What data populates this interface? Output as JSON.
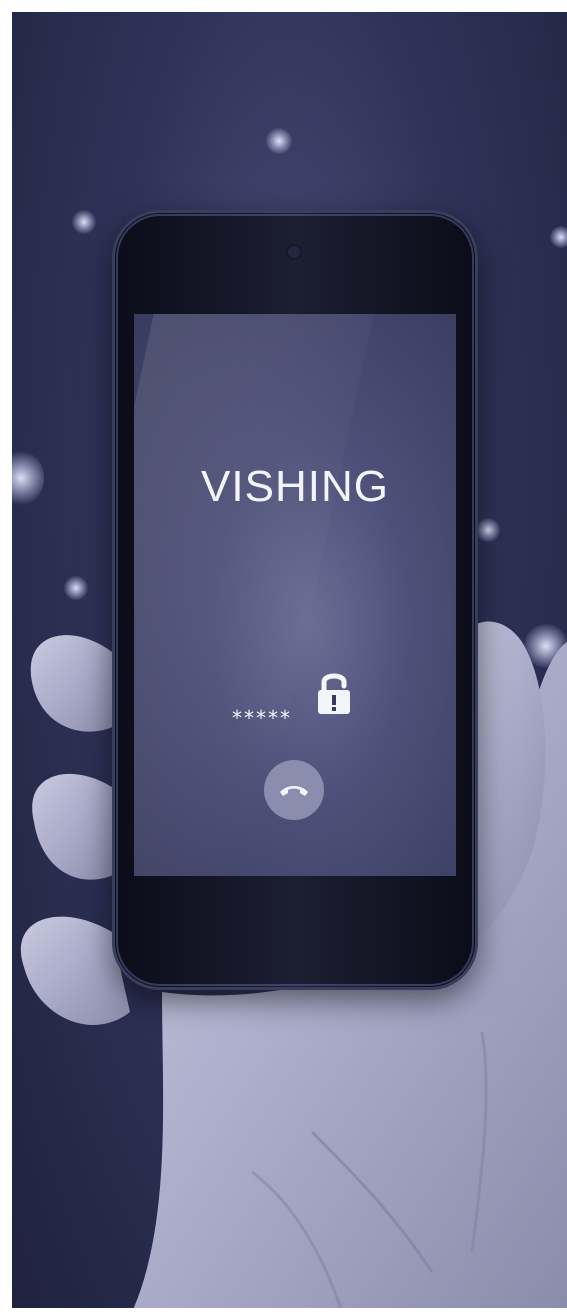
{
  "screen": {
    "title": "VISHING",
    "password_mask": "*****",
    "lock_icon": "padlock-warning-icon",
    "end_call_icon": "phone-hangup-icon"
  },
  "colors": {
    "background": "#2f3358",
    "screen": "#4d5078",
    "text": "#f4f5fb",
    "button": "#8a8dae"
  }
}
